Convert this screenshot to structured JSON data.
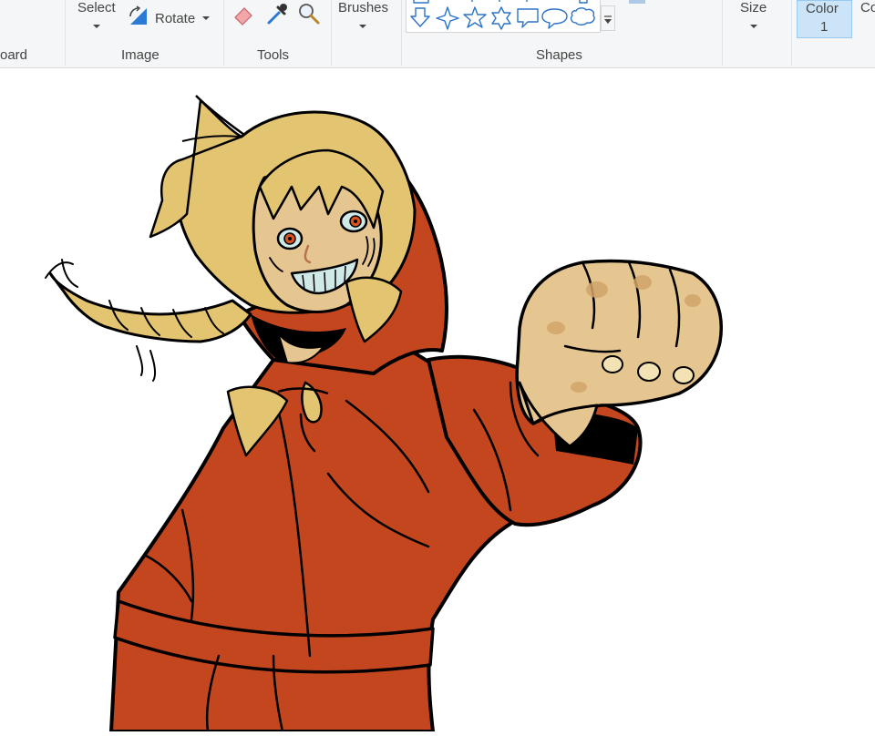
{
  "ribbon": {
    "groups": {
      "clipboard": "oard",
      "image": "Image",
      "tools": "Tools",
      "shapes": "Shapes"
    },
    "buttons": {
      "select": "Select",
      "rotate": "Rotate",
      "brushes": "Brushes",
      "size": "Size",
      "color1_line1": "Color",
      "color1_line2": "1",
      "color2_partial": "Co"
    }
  },
  "colors": {
    "ribbon_bg": "#f5f6f7",
    "selected_button": "#cce4f7",
    "coat": "#c4461f",
    "hair": "#e3c470",
    "skin": "#e6c690",
    "outline": "#000000"
  },
  "canvas": {
    "image_subject": "anime-style drawing of a blond boy in a red hooded coat holding out his fist"
  }
}
